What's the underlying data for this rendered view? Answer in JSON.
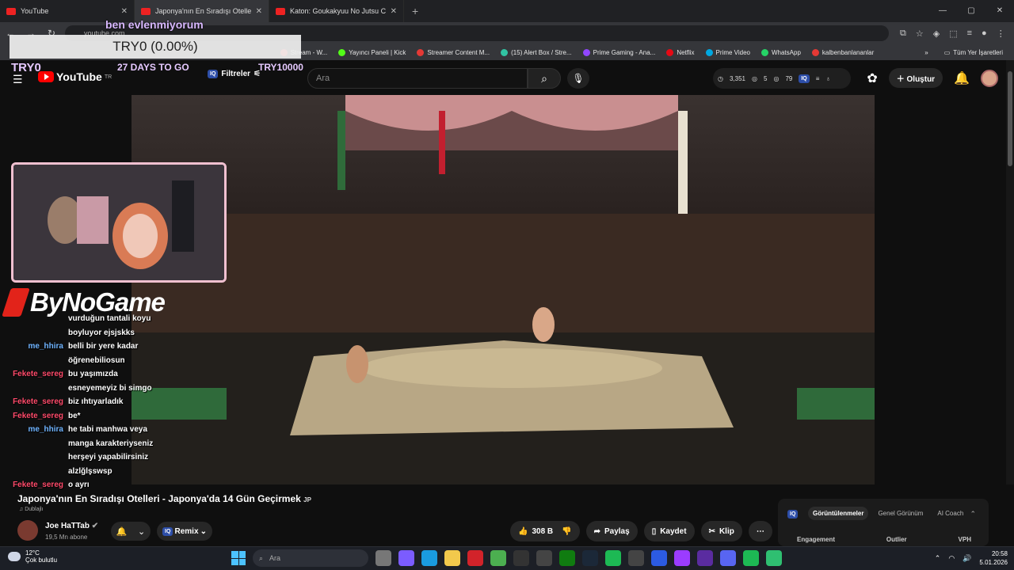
{
  "browser": {
    "tabs": [
      {
        "title": "YouTube",
        "active": false
      },
      {
        "title": "Japonya'nın En Sıradışı Otelleri",
        "active": true
      },
      {
        "title": "Katon: Goukakyuu No Jutsu Ch",
        "active": false
      }
    ],
    "url": "youtube.com",
    "bookmarks": [
      {
        "label": "Stream - W...",
        "color": "#ff4444"
      },
      {
        "label": "Yayıncı Paneli | Kick",
        "color": "#53fc18"
      },
      {
        "label": "Streamer Content M...",
        "color": "#e53935"
      },
      {
        "label": "(15) Alert Box / Stre...",
        "color": "#31c3a2"
      },
      {
        "label": "Prime Gaming - Ana...",
        "color": "#9146ff"
      },
      {
        "label": "Netflix",
        "color": "#e50914"
      },
      {
        "label": "Prime Video",
        "color": "#00a8e1"
      },
      {
        "label": "WhatsApp",
        "color": "#25d366"
      },
      {
        "label": "kalbenbanlananlar",
        "color": "#e53935"
      }
    ],
    "all_bookmarks": "Tüm Yer İşaretleri"
  },
  "overlay": {
    "top_text": "ben evlenmiyorum",
    "goal_box": "TRY0 (0.00%)",
    "goal_left": "TRY0",
    "goal_mid": "27 DAYS TO GO",
    "goal_right": "TRY10000",
    "brand": "ByNoGame"
  },
  "chat": [
    {
      "user": "",
      "msg": "vurduğun tantali koyu",
      "color": "#fff"
    },
    {
      "user": "",
      "msg": "boyluyor ejsjskks",
      "color": "#fff"
    },
    {
      "user": "me_hhira",
      "msg": "belli bir yere kadar",
      "color": "#6fb4ff"
    },
    {
      "user": "",
      "msg": "öğrenebiliosun",
      "color": "#fff"
    },
    {
      "user": "Fekete_sereg",
      "msg": "bu yaşımızda",
      "color": "#ff4a6a"
    },
    {
      "user": "",
      "msg": "esneyemeyiz bi simgo",
      "color": "#fff"
    },
    {
      "user": "Fekete_sereg",
      "msg": "biz ıhtıyarladık",
      "color": "#ff4a6a"
    },
    {
      "user": "Fekete_sereg",
      "msg": "be*",
      "color": "#ff4a6a"
    },
    {
      "user": "me_hhira",
      "msg": "he tabi manhwa veya",
      "color": "#6fb4ff"
    },
    {
      "user": "",
      "msg": "manga karakteriyseniz",
      "color": "#fff"
    },
    {
      "user": "",
      "msg": "herşeyi yapabilirsiniz",
      "color": "#fff"
    },
    {
      "user": "",
      "msg": "alzlğlşswsp",
      "color": "#fff"
    },
    {
      "user": "Fekete_sereg",
      "msg": "o ayrı",
      "color": "#ff4a6a"
    }
  ],
  "youtube": {
    "logo": "YouTube",
    "logo_sup": "TR",
    "filters": "Filtreler",
    "search_placeholder": "Ara",
    "stats": {
      "views": "3,351",
      "a": "5",
      "b": "79"
    },
    "create": "Oluştur"
  },
  "video": {
    "title": "Japonya'nın En Sıradışı Otelleri - Japonya'da 14 Gün Geçirmek",
    "title_suffix": "JP",
    "dub": "Dublajlı",
    "channel": "Joe HaTTab",
    "subs": "19,5 Mn abone",
    "remix": "Remix",
    "likes": "308 B",
    "share": "Paylaş",
    "save": "Kaydet",
    "clip": "Klip"
  },
  "analytics": {
    "tabs": [
      "Görüntülenmeler",
      "Genel Görünüm",
      "AI Coach"
    ],
    "columns": [
      "Engagement",
      "Outlier",
      "VPH"
    ]
  },
  "taskbar": {
    "temp": "12°C",
    "weather": "Çok bulutlu",
    "search": "Ara",
    "time": "20:58",
    "date": "5.01.2026"
  }
}
